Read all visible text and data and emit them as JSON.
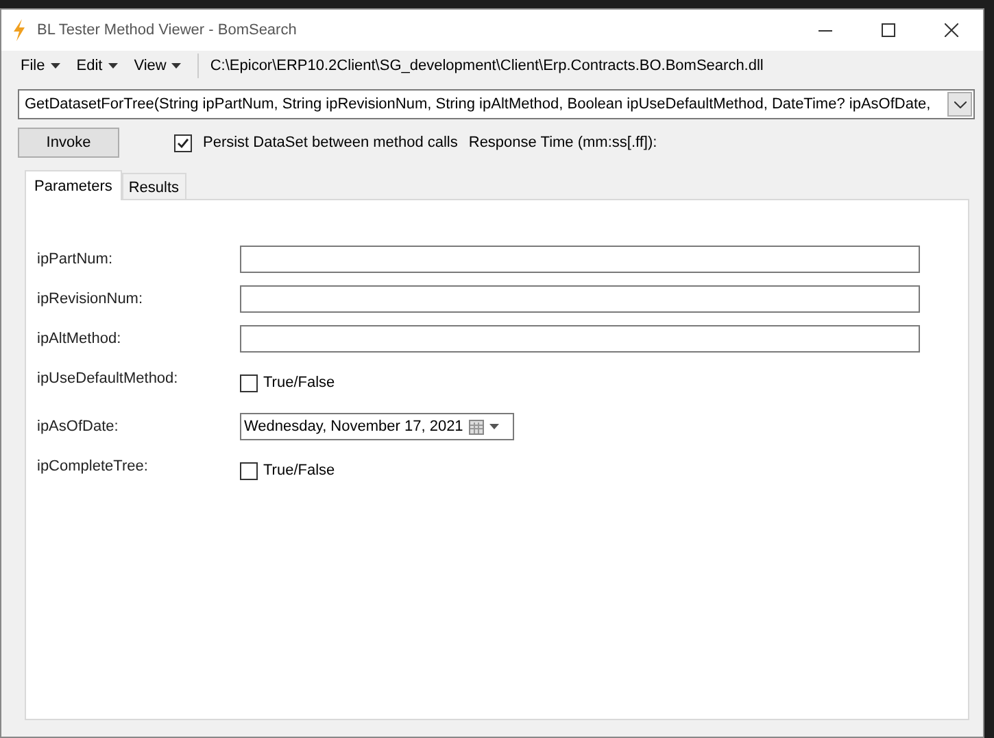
{
  "window": {
    "title": "BL Tester Method Viewer - BomSearch"
  },
  "menu": [
    {
      "label": "File"
    },
    {
      "label": "Edit"
    },
    {
      "label": "View"
    }
  ],
  "assembly_path": "C:\\Epicor\\ERP10.2Client\\SG_development\\Client\\Erp.Contracts.BO.BomSearch.dll",
  "method_select": {
    "value": "GetDatasetForTree(String ipPartNum, String ipRevisionNum, String ipAltMethod, Boolean ipUseDefaultMethod, DateTime? ipAsOfDate,"
  },
  "invoke_button": "Invoke",
  "persist": {
    "label": "Persist DataSet between method calls",
    "checked": true
  },
  "response_time_label": "Response Time (mm:ss[.ff]):",
  "tabs": [
    {
      "label": "Parameters",
      "selected": true
    },
    {
      "label": "Results",
      "selected": false
    }
  ],
  "parameters": [
    {
      "name": "ipPartNum:",
      "kind": "text"
    },
    {
      "name": "ipRevisionNum:",
      "kind": "text"
    },
    {
      "name": "ipAltMethod:",
      "kind": "text"
    },
    {
      "name": "ipUseDefaultMethod:",
      "kind": "checkbox",
      "label": "True/False",
      "checked": false
    },
    {
      "name": "ipAsOfDate:",
      "kind": "date",
      "value": "Wednesday, November 17, 2021"
    },
    {
      "name": "ipCompleteTree:",
      "kind": "checkbox",
      "label": "True/False",
      "checked": false
    }
  ]
}
